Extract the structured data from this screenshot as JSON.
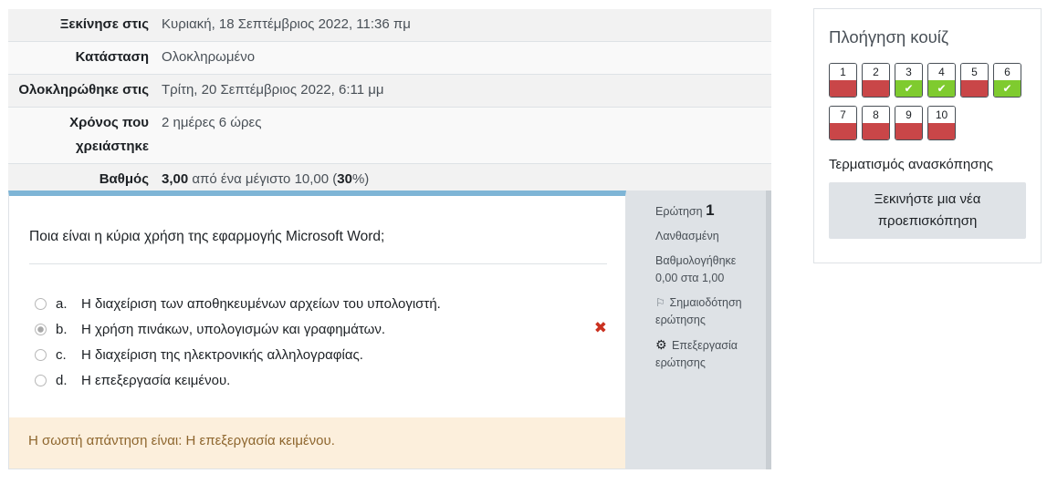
{
  "summary": {
    "rows": [
      {
        "label": "Ξεκίνησε στις",
        "value": "Κυριακή, 18 Σεπτέμβριος 2022, 11:36 πμ"
      },
      {
        "label": "Κατάσταση",
        "value": "Ολοκληρωμένο"
      },
      {
        "label": "Ολοκληρώθηκε στις",
        "value": "Τρίτη, 20 Σεπτέμβριος 2022, 6:11 μμ"
      },
      {
        "label": "Χρόνος που χρειάστηκε",
        "value": "2 ημέρες 6 ώρες"
      }
    ],
    "grade": {
      "label": "Βαθμός",
      "score": "3,00",
      "mid": " από ένα μέγιστο 10,00 (",
      "percent": "30",
      "tail": "%)"
    }
  },
  "question": {
    "text": "Ποια είναι η κύρια χρήση της εφαρμογής Microsoft Word;",
    "answers": [
      {
        "letter": "a.",
        "text": "Η διαχείριση των αποθηκευμένων αρχείων του υπολογιστή."
      },
      {
        "letter": "b.",
        "text": "Η χρήση πινάκων, υπολογισμών και γραφημάτων."
      },
      {
        "letter": "c.",
        "text": "Η διαχείριση της ηλεκτρονικής αλληλογραφίας."
      },
      {
        "letter": "d.",
        "text": "Η επεξεργασία κειμένου."
      }
    ],
    "feedback": "Η σωστή απάντηση είναι: Η επεξεργασία κειμένου.",
    "incorrect_mark": "✖"
  },
  "qinfo": {
    "label": "Ερώτηση",
    "number": "1",
    "state": "Λανθασμένη",
    "graded_line1": "Βαθμολογήθηκε",
    "graded_line2": "0,00 στα 1,00",
    "flag_line1": "Σημαιοδότηση",
    "flag_line2": "ερώτησης",
    "edit_line1": "Επεξεργασία",
    "edit_line2": "ερώτησης"
  },
  "nav": {
    "title": "Πλοήγηση κουίζ",
    "buttons": [
      {
        "num": "1",
        "state": "wrong"
      },
      {
        "num": "2",
        "state": "wrong"
      },
      {
        "num": "3",
        "state": "right"
      },
      {
        "num": "4",
        "state": "right"
      },
      {
        "num": "5",
        "state": "wrong"
      },
      {
        "num": "6",
        "state": "right"
      },
      {
        "num": "7",
        "state": "wrong"
      },
      {
        "num": "8",
        "state": "wrong"
      },
      {
        "num": "9",
        "state": "wrong"
      },
      {
        "num": "10",
        "state": "wrong"
      }
    ],
    "finish_review": "Τερματισμός ανασκόπησης",
    "new_preview_line1": "Ξεκινήστε μια νέα",
    "new_preview_line2": "προεπισκόπηση"
  },
  "colors": {
    "wrong": "#c94648",
    "right": "#7fcb2f",
    "accent": "#7eb5d6",
    "feedback_bg": "#fcefdc"
  }
}
